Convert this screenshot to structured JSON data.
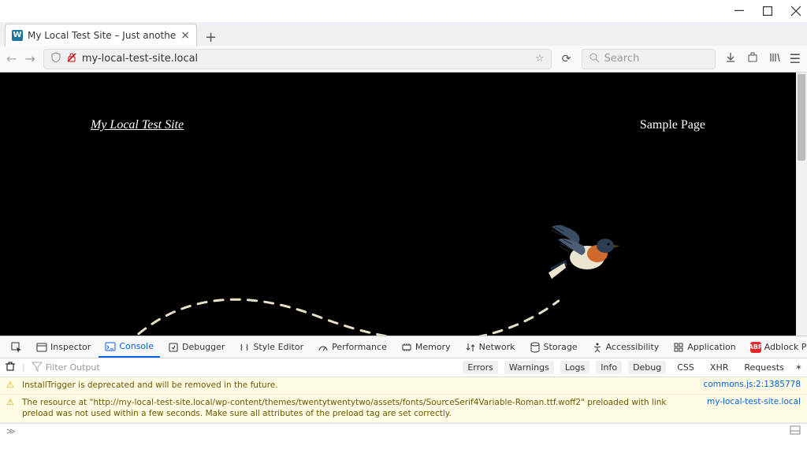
{
  "window": {
    "tab_title": "My Local Test Site – Just anothe"
  },
  "url_toolbar": {
    "url": "my-local-test-site.local",
    "search_placeholder": "Search"
  },
  "page": {
    "site_title": "My Local Test Site",
    "nav_link": "Sample Page"
  },
  "devtools": {
    "tabs": {
      "inspector": "Inspector",
      "console": "Console",
      "debugger": "Debugger",
      "styleeditor": "Style Editor",
      "performance": "Performance",
      "memory": "Memory",
      "network": "Network",
      "storage": "Storage",
      "accessibility": "Accessibility",
      "application": "Application",
      "adblock": "Adblock Plus"
    },
    "filter": {
      "placeholder": "Filter Output",
      "cats": {
        "errors": "Errors",
        "warnings": "Warnings",
        "logs": "Logs",
        "info": "Info",
        "debug": "Debug",
        "css": "CSS",
        "xhr": "XHR",
        "requests": "Requests"
      }
    },
    "messages": [
      {
        "text": "InstallTrigger is deprecated and will be removed in the future.",
        "source": "commons.js:2:1385778"
      },
      {
        "text": "The resource at \"http://my-local-test-site.local/wp-content/themes/twentytwentytwo/assets/fonts/SourceSerif4Variable-Roman.ttf.woff2\" preloaded with link preload was not used within a few seconds. Make sure all attributes of the preload tag are set correctly.",
        "source": "my-local-test-site.local"
      }
    ]
  }
}
